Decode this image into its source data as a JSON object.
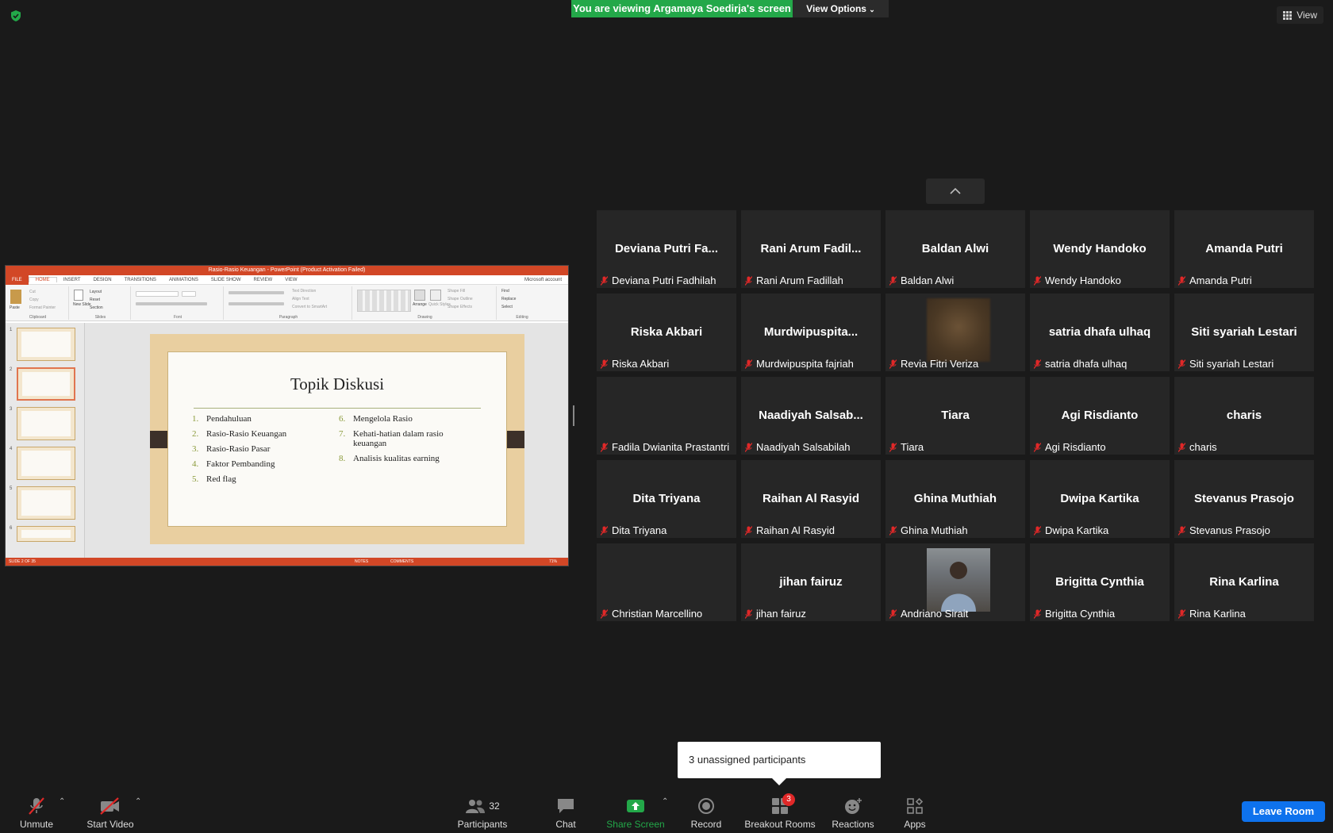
{
  "banner": {
    "viewing": "You are viewing Argamaya Soedirja's screen",
    "view_options": "View Options"
  },
  "view_button": "View",
  "shared_screen": {
    "window_title": "Rasio-Rasio Keuangan - PowerPoint (Product Activation Failed)",
    "tabs": [
      "FILE",
      "HOME",
      "INSERT",
      "DESIGN",
      "TRANSITIONS",
      "ANIMATIONS",
      "SLIDE SHOW",
      "REVIEW",
      "VIEW"
    ],
    "account": "Microsoft account",
    "ribbon_groups": [
      "Clipboard",
      "Slides",
      "Font",
      "Paragraph",
      "Drawing",
      "Editing"
    ],
    "ribbon_items": {
      "paste": "Paste",
      "cut": "Cut",
      "copy": "Copy",
      "format_painter": "Format Painter",
      "new_slide": "New Slide",
      "layout": "Layout",
      "reset": "Reset",
      "section": "Section",
      "text_direction": "Text Direction",
      "align_text": "Align Text",
      "smartart": "Convert to SmartArt",
      "arrange": "Arrange",
      "quick_styles": "Quick Styles",
      "shape_fill": "Shape Fill",
      "shape_outline": "Shape Outline",
      "shape_effects": "Shape Effects",
      "find": "Find",
      "replace": "Replace",
      "select": "Select"
    },
    "slide": {
      "title": "Topik Diskusi",
      "left_items": [
        {
          "n": "1.",
          "t": "Pendahuluan"
        },
        {
          "n": "2.",
          "t": "Rasio-Rasio Keuangan"
        },
        {
          "n": "3.",
          "t": "Rasio-Rasio Pasar"
        },
        {
          "n": "4.",
          "t": "Faktor Pembanding"
        },
        {
          "n": "5.",
          "t": "Red flag"
        }
      ],
      "right_items": [
        {
          "n": "6.",
          "t": "Mengelola Rasio"
        },
        {
          "n": "7.",
          "t": "Kehati-hatian dalam rasio keuangan"
        },
        {
          "n": "8.",
          "t": "Analisis kualitas earning"
        }
      ]
    },
    "thumb_numbers": [
      "1",
      "2",
      "3",
      "4",
      "5",
      "6"
    ],
    "status_left": "SLIDE 2 OF 35",
    "status_notes": "NOTES",
    "status_comments": "COMMENTS",
    "zoom": "71%"
  },
  "participants_tiles": [
    {
      "big": "Deviana Putri Fa...",
      "name": "Deviana Putri Fadhilah"
    },
    {
      "big": "Rani Arum Fadil...",
      "name": "Rani Arum Fadillah"
    },
    {
      "big": "Baldan Alwi",
      "name": "Baldan Alwi"
    },
    {
      "big": "Wendy Handoko",
      "name": "Wendy Handoko"
    },
    {
      "big": "Amanda Putri",
      "name": "Amanda Putri"
    },
    {
      "big": "Riska Akbari",
      "name": "Riska Akbari"
    },
    {
      "big": "Murdwipuspita...",
      "name": "Murdwipuspita fajriah"
    },
    {
      "big": "",
      "name": "Revia Fitri Veriza",
      "photo": "blurred"
    },
    {
      "big": "satria dhafa ulhaq",
      "name": "satria dhafa ulhaq"
    },
    {
      "big": "Siti syariah Lestari",
      "name": "Siti syariah Lestari"
    },
    {
      "big": "",
      "name": "Fadila Dwianita Prastantri"
    },
    {
      "big": "Naadiyah Salsab...",
      "name": "Naadiyah Salsabilah"
    },
    {
      "big": "Tiara",
      "name": "Tiara"
    },
    {
      "big": "Agi Risdianto",
      "name": "Agi Risdianto"
    },
    {
      "big": "charis",
      "name": "charis"
    },
    {
      "big": "Dita Triyana",
      "name": "Dita Triyana"
    },
    {
      "big": "Raihan Al Rasyid",
      "name": "Raihan Al Rasyid"
    },
    {
      "big": "Ghina Muthiah",
      "name": "Ghina Muthiah"
    },
    {
      "big": "Dwipa Kartika",
      "name": "Dwipa Kartika"
    },
    {
      "big": "Stevanus Prasojo",
      "name": "Stevanus Prasojo"
    },
    {
      "big": "",
      "name": "Christian Marcellino"
    },
    {
      "big": "jihan fairuz",
      "name": "jihan fairuz"
    },
    {
      "big": "",
      "name": "Andriano Sirait",
      "photo": "person"
    },
    {
      "big": "Brigitta Cynthia",
      "name": "Brigitta Cynthia"
    },
    {
      "big": "Rina Karlina",
      "name": "Rina Karlina"
    }
  ],
  "tooltip": "3 unassigned participants",
  "toolbar": {
    "unmute": "Unmute",
    "start_video": "Start Video",
    "participants": "Participants",
    "participants_count": "32",
    "chat": "Chat",
    "share_screen": "Share Screen",
    "record": "Record",
    "breakout_rooms": "Breakout Rooms",
    "breakout_badge": "3",
    "reactions": "Reactions",
    "apps": "Apps",
    "leave_room": "Leave Room"
  },
  "colors": {
    "banner_green": "#23a849",
    "leave_blue": "#0e72ed",
    "share_green": "#23a849",
    "mute_red": "#e02828",
    "ppt_orange": "#d24726"
  }
}
